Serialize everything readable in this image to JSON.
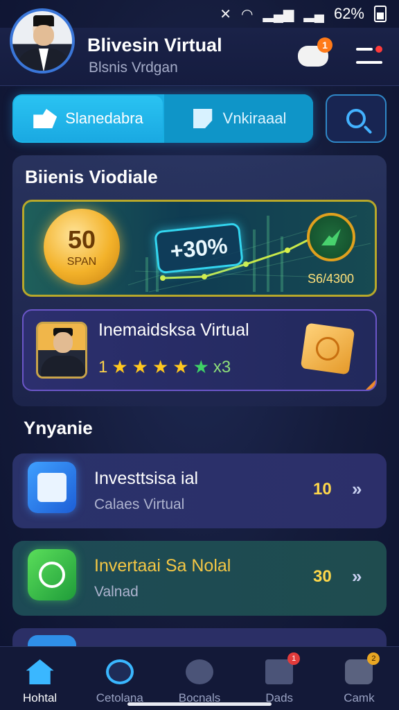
{
  "status_bar": {
    "battery": "62%",
    "icons": [
      "mute-icon",
      "wifi-icon",
      "signal-icon",
      "signal-icon-2",
      "battery-icon"
    ]
  },
  "header": {
    "name": "Blivesin Virtual",
    "subtitle": "Blsnis Vrdgan",
    "notification_count": "1"
  },
  "tabs": [
    {
      "label": "Slanedabra",
      "active": true
    },
    {
      "label": "Vnkiraaal",
      "active": false
    }
  ],
  "section1": {
    "title": "Biienis Viodiale",
    "promo": {
      "coin_value": "50",
      "coin_label": "SPAN",
      "percent": "+30%",
      "value": "S6/4300"
    },
    "profile": {
      "title": "Inemaidsksa Virtual",
      "rating": "1",
      "count": "x3"
    }
  },
  "section2": {
    "title": "Ynyanie",
    "items": [
      {
        "title": "Investtsisa ial",
        "subtitle": "Calaes Virtual",
        "count": "10",
        "color": "#ffd84a"
      },
      {
        "title": "Invertaai Sa Nolal",
        "subtitle": "Valnad",
        "count": "30",
        "color": "#f5c744"
      }
    ]
  },
  "bottom_nav": [
    {
      "label": "Hohtal",
      "icon": "home-icon",
      "active": true
    },
    {
      "label": "Cetolana",
      "icon": "categories-icon",
      "active": false
    },
    {
      "label": "Bocnals",
      "icon": "social-icon",
      "active": false
    },
    {
      "label": "Dads",
      "icon": "dads-icon",
      "active": false,
      "badge": "1"
    },
    {
      "label": "Camk",
      "icon": "camera-icon",
      "active": false,
      "badge": "2"
    }
  ]
}
